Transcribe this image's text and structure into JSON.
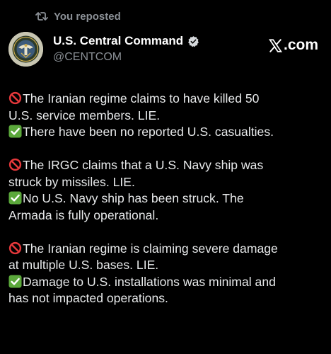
{
  "repost": {
    "label": "You reposted",
    "icon": "repost-icon"
  },
  "author": {
    "name": "U.S. Central Command",
    "handle": "@CENTCOM",
    "verified": true,
    "avatar_icon": "centcom-seal"
  },
  "brand": {
    "label": ".com",
    "icon": "x-logo-icon"
  },
  "post": {
    "paragraphs": [
      {
        "line1_emoji": "prohibited-icon",
        "line1": "The Iranian regime claims to have killed 50",
        "line2": "U.S. service members. LIE.",
        "line3_emoji": "check-mark-icon",
        "line3": "There have been no reported U.S. casualties."
      },
      {
        "line1_emoji": "prohibited-icon",
        "line1": "The IRGC claims that a U.S. Navy ship was",
        "line2": "struck by missiles. LIE.",
        "line3_emoji": "check-mark-icon",
        "line3": "No U.S. Navy ship has been struck. The",
        "line4": "Armada is fully operational."
      },
      {
        "line1_emoji": "prohibited-icon",
        "line1": "The Iranian regime is claiming severe damage",
        "line2": "at multiple U.S. bases. LIE.",
        "line3_emoji": "check-mark-icon",
        "line3": "Damage to U.S. installations was minimal and",
        "line4": "has not impacted operations."
      }
    ]
  },
  "colors": {
    "background": "#000000",
    "text": "#e7e9ea",
    "secondary_text": "#8b9096",
    "prohibited_red": "#e5383b",
    "check_green": "#5ba83b",
    "verified_badge": "#d6d9dc"
  }
}
